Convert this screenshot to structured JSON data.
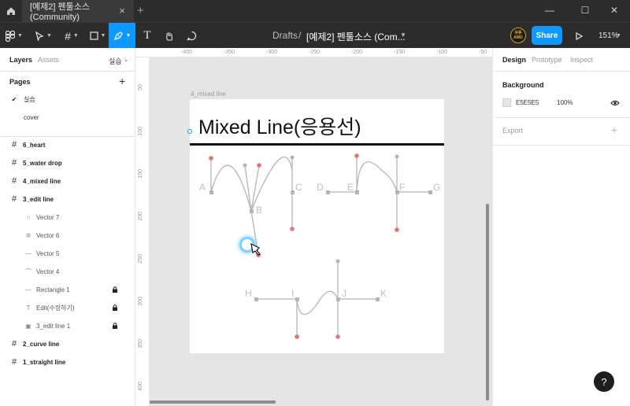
{
  "titlebar": {
    "tab_title": "[예제2] 펜툴소스 (Community)"
  },
  "toolbar": {
    "breadcrumb_root": "Drafts",
    "breadcrumb_sep": "/",
    "file_title": "[예제2] 펜툴소스 (Com...",
    "share_label": "Share",
    "zoom": "151%",
    "avatar_text": "유튜\nAMO"
  },
  "left_panel": {
    "tab_layers": "Layers",
    "tab_assets": "Assets",
    "page_selector": "실습",
    "pages_header": "Pages",
    "pages": [
      {
        "label": "실습",
        "current": true
      },
      {
        "label": "cover",
        "current": false
      }
    ],
    "layers": [
      {
        "label": "6_heart",
        "icon": "frame-icon",
        "indent": 0,
        "locked": false
      },
      {
        "label": "5_water drop",
        "icon": "frame-icon",
        "indent": 0,
        "locked": false
      },
      {
        "label": "4_mixed line",
        "icon": "frame-icon",
        "indent": 0,
        "locked": false
      },
      {
        "label": "3_edit line",
        "icon": "frame-icon",
        "indent": 0,
        "locked": false
      },
      {
        "label": "Vector 7",
        "icon": "circle-icon",
        "indent": 1,
        "locked": false
      },
      {
        "label": "Vector 6",
        "icon": "star-icon",
        "indent": 1,
        "locked": false
      },
      {
        "label": "Vector 5",
        "icon": "line-icon",
        "indent": 1,
        "locked": false
      },
      {
        "label": "Vector 4",
        "icon": "curve-icon",
        "indent": 1,
        "locked": false
      },
      {
        "label": "Rectangle 1",
        "icon": "line-icon",
        "indent": 1,
        "locked": true
      },
      {
        "label": "Edit(수정하기)",
        "icon": "text-icon",
        "indent": 1,
        "locked": true
      },
      {
        "label": "3_edit line 1",
        "icon": "image-icon",
        "indent": 1,
        "locked": true
      },
      {
        "label": "2_curve line",
        "icon": "frame-icon",
        "indent": 0,
        "locked": false
      },
      {
        "label": "1_straight line",
        "icon": "frame-icon",
        "indent": 0,
        "locked": false
      }
    ]
  },
  "rulers": {
    "top": [
      "-400",
      "-350",
      "-300",
      "-250",
      "-200",
      "-150",
      "-100",
      "-50"
    ],
    "left": [
      "50",
      "100",
      "150",
      "200",
      "250",
      "300",
      "350",
      "400"
    ]
  },
  "canvas": {
    "frame_label": "4_mixed line",
    "heading": "Mixed Line(응용선)",
    "point_labels": [
      "A",
      "B",
      "C",
      "D",
      "E",
      "F",
      "G",
      "H",
      "I",
      "J",
      "K"
    ]
  },
  "right_panel": {
    "tab_design": "Design",
    "tab_prototype": "Prototype",
    "tab_inspect": "Inspect",
    "background_header": "Background",
    "bg_hex": "E5E5E5",
    "bg_opacity": "100%",
    "export_header": "Export"
  },
  "colors": {
    "accent": "#0d99ff",
    "anchor_red": "#e57373",
    "handle_gray": "#b0b0b0"
  }
}
